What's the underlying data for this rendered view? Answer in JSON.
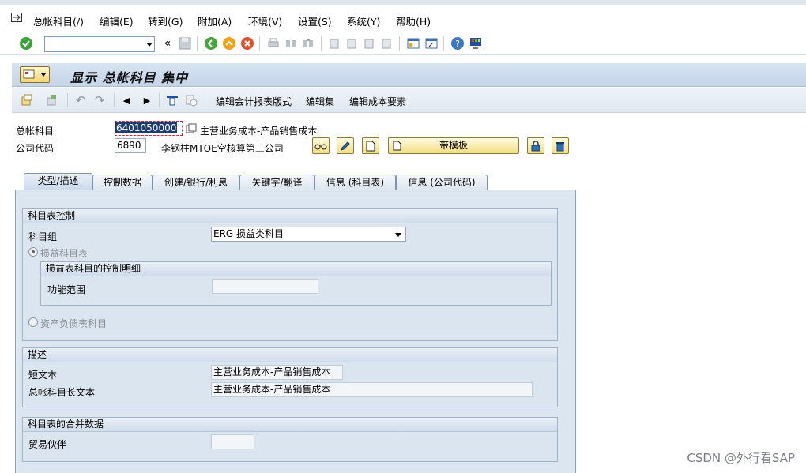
{
  "menu": [
    "总帐科目(/)",
    "编辑(E)",
    "转到(G)",
    "附加(A)",
    "环境(V)",
    "设置(S)",
    "系统(Y)",
    "帮助(H)"
  ],
  "title": "显示 总帐科目 集中",
  "app_toolbar": {
    "edit_report_layout": "编辑会计报表版式",
    "edit_set": "编辑集",
    "edit_cost_element": "编辑成本要素"
  },
  "header": {
    "gl_account_label": "总帐科目",
    "gl_account_value": "6401050000",
    "gl_account_desc": "主营业务成本-产品销售成本",
    "company_code_label": "公司代码",
    "company_code_value": "6890",
    "company_code_desc": "李钢柱MTOE空核算第三公司",
    "template_button": "带模板"
  },
  "tabs": [
    {
      "label": "类型/描述",
      "active": true
    },
    {
      "label": "控制数据",
      "active": false
    },
    {
      "label": "创建/银行/利息",
      "active": false
    },
    {
      "label": "关键字/翻译",
      "active": false
    },
    {
      "label": "信息 (科目表)",
      "active": false
    },
    {
      "label": "信息 (公司代码)",
      "active": false
    }
  ],
  "coa_control": {
    "heading": "科目表控制",
    "account_group_label": "科目组",
    "account_group_value": "ERG 损益类科目",
    "pl_radio_label": "损益科目表",
    "pl_detail_heading": "损益表科目的控制明细",
    "functional_area_label": "功能范围",
    "functional_area_value": "",
    "bs_radio_label": "资产负债表科目"
  },
  "description": {
    "heading": "描述",
    "short_text_label": "短文本",
    "short_text_value": "主营业务成本-产品销售成本",
    "long_text_label": "总帐科目长文本",
    "long_text_value": "主营业务成本-产品销售成本"
  },
  "consolidation": {
    "heading": "科目表的合并数据",
    "trading_partner_label": "贸易伙伴",
    "trading_partner_value": ""
  },
  "watermark": "CSDN @外行看SAP"
}
